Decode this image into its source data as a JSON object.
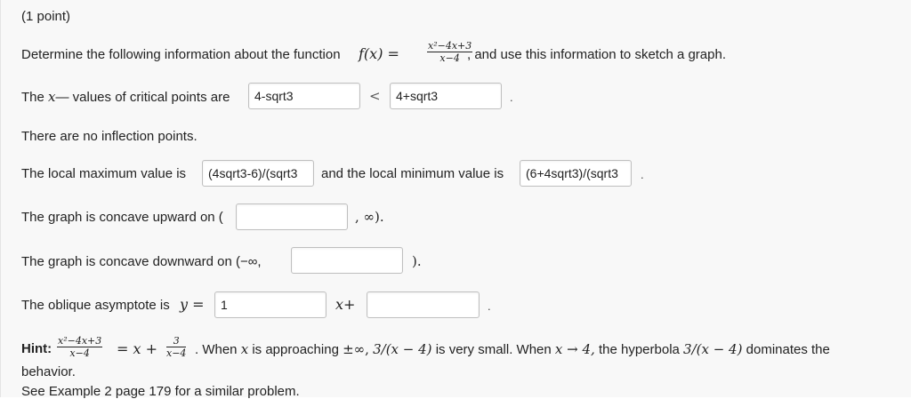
{
  "point_label": "(1 point)",
  "intro": {
    "before": "Determine the following information about the function",
    "fx": "f(x) =",
    "frac_num": "x²−4x+3",
    "frac_den": "x−4",
    "after": ", and use this information to sketch a graph."
  },
  "critical": {
    "label_a": "The",
    "label_var": "x",
    "label_b": "— values of critical points are",
    "first_value": "4-sqrt3",
    "less_than": "<",
    "second_value": "4+sqrt3",
    "dot": "."
  },
  "inflection": {
    "text": "There are no inflection points."
  },
  "extrema": {
    "max_label": "The local maximum value is",
    "max_value": "(4sqrt3-6)/(sqrt3",
    "min_label": "and the local minimum value is",
    "min_value": "(6+4sqrt3)/(sqrt3",
    "dot": "."
  },
  "concave_up": {
    "label": "The graph is concave upward on (",
    "value": "",
    "suffix": ", ∞)."
  },
  "concave_down": {
    "label": "The graph is concave downward on (−∞,",
    "value": "",
    "suffix": ")."
  },
  "asymptote": {
    "label": "The oblique asymptote is",
    "y_eq": "y =",
    "slope_value": "1",
    "x_plus": "x+",
    "intercept_value": "",
    "dot": "."
  },
  "hint": {
    "label": "Hint:",
    "f_num": "x²−4x+3",
    "f_den": "x−4",
    "eq": "= x +",
    "g_num": "3",
    "g_den": "x−4",
    "text_a": ". When",
    "var_x": "x",
    "text_b": "is approaching",
    "pm_inf": "±∞,",
    "expr": "3/(x − 4)",
    "text_c": "is very small. When",
    "arrow_expr": "x → 4,",
    "text_d": "the hyperbola",
    "expr2": "3/(x − 4)",
    "text_e": "dominates the",
    "line2": "behavior.",
    "line3": "See Example 2 page 179 for a similar problem."
  }
}
